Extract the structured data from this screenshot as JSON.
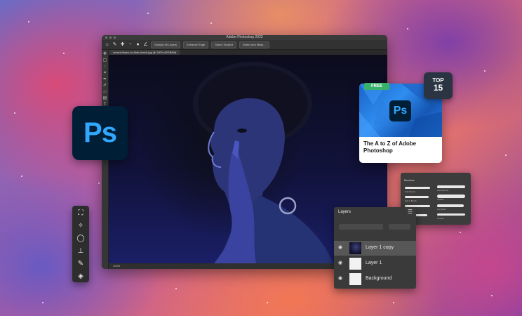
{
  "window": {
    "title": "Adobe Photoshop 2022",
    "doc_tab": "cursed-faces-no-kids-bench.jpg @ 100% (RGB/8#)",
    "options_buttons": [
      "Sample All Layers",
      "Enhance Edge",
      "Select Subject",
      "Select and Mask..."
    ],
    "status_zoom": "100%"
  },
  "ps_logo": "Ps",
  "card": {
    "badge": "FREE",
    "logo": "Ps",
    "title": "The A to Z of Adobe Photoshop"
  },
  "top_badge": {
    "label": "TOP",
    "number": "15"
  },
  "brushes_panel": {
    "title": "Brushes",
    "items": [
      "Soft Round",
      "Hard Round",
      "Kyle's Brush",
      "Spatter",
      "Dry Media",
      "Ink Brush",
      "Wet Media",
      "Texture"
    ]
  },
  "layers_panel": {
    "title": "Layers",
    "layers": [
      {
        "name": "Layer 1 copy"
      },
      {
        "name": "Layer 1"
      },
      {
        "name": "Background"
      }
    ]
  }
}
